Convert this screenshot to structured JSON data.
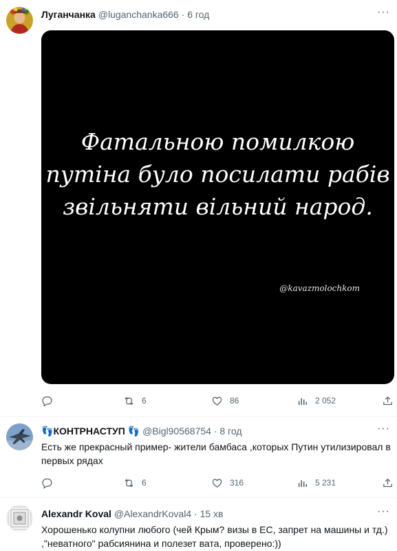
{
  "tweets": [
    {
      "name": "Луганчанка",
      "handle": "@luganchanka666",
      "time": "6 год",
      "more": "···",
      "image_text": [
        "Фатальною помилкою",
        "путіна було посилати рабів",
        "звільняти вільний народ."
      ],
      "watermark": "@kavazmolochkom",
      "replies": "",
      "retweets": "6",
      "likes": "86",
      "views": "2 052"
    },
    {
      "name": "КОНТРНАСТУП",
      "name_emoji": "👣",
      "handle": "@Bigl90568754",
      "time": "8 год",
      "more": "···",
      "text": "Есть же прекрасный пример- жители бамбаса ,которых Путин утилизировал в первых рядах",
      "replies": "",
      "retweets": "6",
      "likes": "316",
      "views": "5 231"
    },
    {
      "name": "Alexandr Koval",
      "handle": "@AlexandrKoval4",
      "time": "15 хв",
      "more": "···",
      "text": "Хорошенько колупни любого (чей Крым? визы в ЕС, запрет на машины и тд.) ,\"неватного\" рабсиянина и полезет вата, проверено:))"
    }
  ],
  "colors": {
    "text": "#0f1419",
    "secondary": "#536471",
    "media_bg": "#000000",
    "separator": "#eff3f4"
  },
  "icons": [
    "reply-icon",
    "retweet-icon",
    "like-icon",
    "views-icon",
    "share-icon",
    "more-icon"
  ]
}
